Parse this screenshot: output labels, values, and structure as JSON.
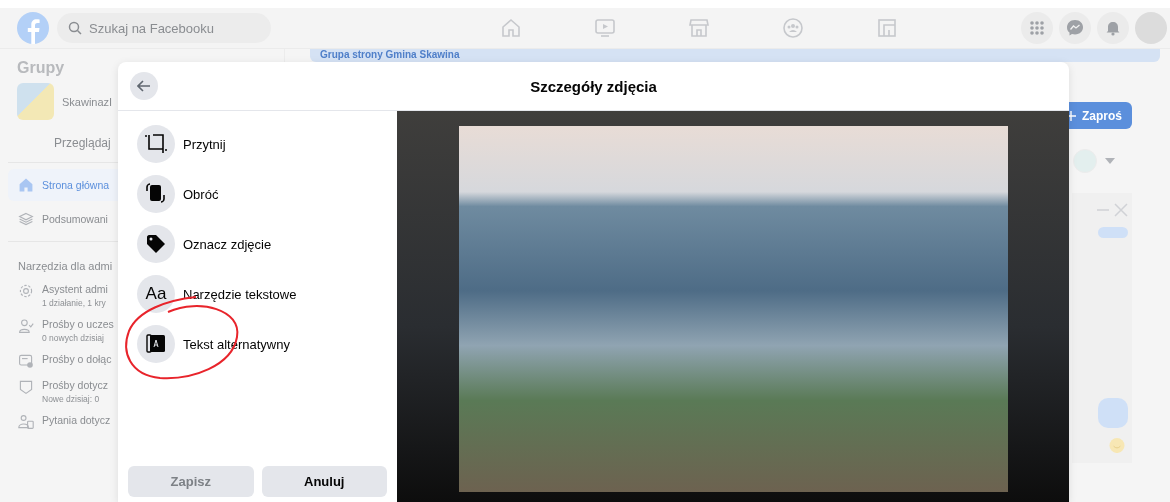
{
  "topbar": {
    "search": {
      "placeholder": "Szukaj na Facebooku"
    },
    "nav": [
      {
        "kind": "home"
      },
      {
        "kind": "video"
      },
      {
        "kind": "store"
      },
      {
        "kind": "groups"
      },
      {
        "kind": "gaming"
      }
    ],
    "actions": [
      {
        "kind": "apps"
      },
      {
        "kind": "messenger"
      },
      {
        "kind": "bell"
      },
      {
        "kind": "avatar"
      }
    ]
  },
  "sidebar": {
    "title": "Grupy",
    "group": {
      "name": "SkawinazI"
    },
    "browse": "Przeglądaj",
    "items": [
      {
        "label": "Strona główna",
        "kind": "home",
        "selected": true
      },
      {
        "label": "Podsumowani",
        "kind": "layers",
        "selected": false
      }
    ],
    "admin_title": "Narzędzia dla admi",
    "admin_items": [
      {
        "label": "Asystent admi",
        "sub": "1 działanie, 1 kry",
        "kind": "gear"
      },
      {
        "label": "Prośby o uczes",
        "sub": "0 nowych dzisiaj",
        "kind": "person"
      },
      {
        "label": "Prośby o dołąc",
        "kind": "card"
      },
      {
        "label": "Prośby dotycz",
        "sub": "Nowe dzisiaj: 0",
        "kind": "shield"
      },
      {
        "label": "Pytania dotycz",
        "kind": "people"
      }
    ]
  },
  "main": {
    "banner": "Grupa strony Gmina Skawina",
    "invite": "Zaproś"
  },
  "modal": {
    "title": "Szczegóły zdjęcia",
    "tools": [
      {
        "label": "Przytnij",
        "kind": "crop"
      },
      {
        "label": "Obróć",
        "kind": "rotate"
      },
      {
        "label": "Oznacz zdjęcie",
        "kind": "tag"
      },
      {
        "label": "Narzędzie tekstowe",
        "kind": "text",
        "glyph": "Aa"
      },
      {
        "label": "Tekst alternatywny",
        "kind": "alt"
      }
    ],
    "buttons": [
      {
        "label": "Zapisz",
        "disabled": true
      },
      {
        "label": "Anuluj",
        "disabled": false
      }
    ],
    "annotation": {
      "kind": "circle"
    }
  }
}
